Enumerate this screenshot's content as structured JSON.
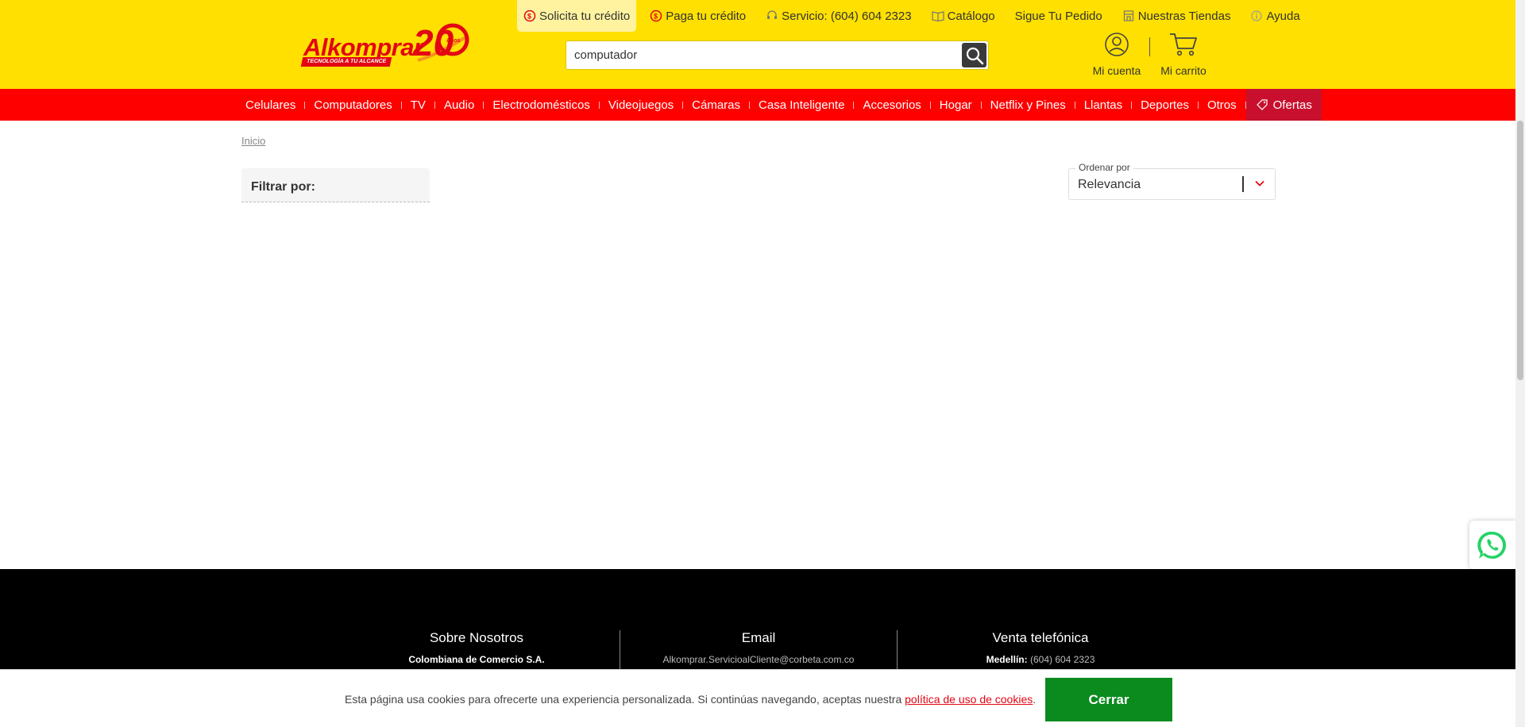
{
  "brand": {
    "name": "Alkomprar",
    "tagline": "TECNOLOGÍA A TU ALCANCE",
    "anniversary_number": "20",
    "anniversary_word": "Años",
    "colors": {
      "yellow": "#ffe000",
      "red": "#ff0000",
      "dark_red": "#c8102e",
      "green": "#0b8a1e"
    }
  },
  "top_links": [
    {
      "label": "Solicita tu crédito",
      "icon": "credit-coin-icon"
    },
    {
      "label": "Paga tu crédito",
      "icon": "credit-coin-icon"
    },
    {
      "label": "Servicio: (604) 604 2323",
      "icon": "headset-icon"
    },
    {
      "label": "Catálogo",
      "icon": "catalog-book-icon"
    },
    {
      "label": "Sigue Tu Pedido",
      "icon": ""
    },
    {
      "label": "Nuestras Tiendas",
      "icon": "store-icon"
    },
    {
      "label": "Ayuda",
      "icon": "help-icon"
    }
  ],
  "search": {
    "value": "computador",
    "icon": "search-icon"
  },
  "user": {
    "account_label": "Mi cuenta",
    "cart_label": "Mi carrito"
  },
  "categories": [
    "Celulares",
    "Computadores",
    "TV",
    "Audio",
    "Electrodomésticos",
    "Videojuegos",
    "Cámaras",
    "Casa Inteligente",
    "Accesorios",
    "Hogar",
    "Netflix y Pines",
    "Llantas",
    "Deportes",
    "Otros"
  ],
  "offers_label": "Ofertas",
  "breadcrumb": "Inicio",
  "filter": {
    "title": "Filtrar por:"
  },
  "sort": {
    "legend": "Ordenar por",
    "value": "Relevancia"
  },
  "footer": {
    "about": {
      "title": "Sobre Nosotros",
      "text": "Colombiana de Comercio S.A."
    },
    "email": {
      "title": "Email",
      "text": "Alkomprar.ServicioalCliente@corbeta.com.co"
    },
    "phone": {
      "title": "Venta telefónica",
      "city": "Medellín:",
      "number": "(604) 604 2323"
    }
  },
  "cookie": {
    "message": "Esta página usa cookies para ofrecerte una experiencia personalizada. Si continúas navegando, aceptas nuestra",
    "link": "política de uso de cookies",
    "suffix": ".",
    "button": "Cerrar"
  }
}
